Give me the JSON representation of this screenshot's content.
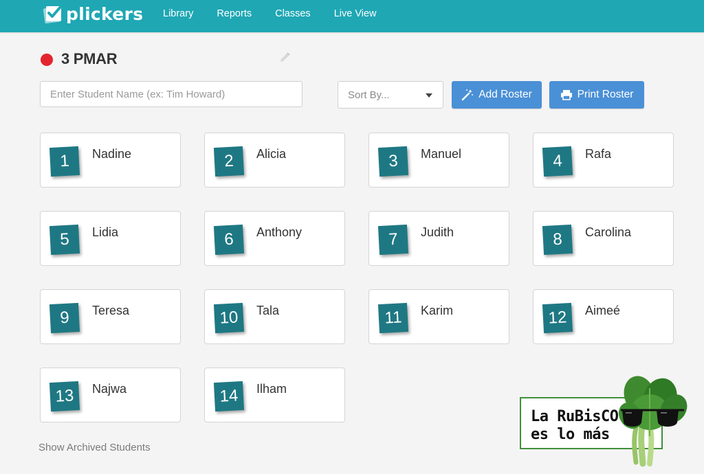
{
  "app": {
    "logo_text": "plickers"
  },
  "nav": {
    "items": [
      {
        "label": "Library"
      },
      {
        "label": "Reports"
      },
      {
        "label": "Classes"
      },
      {
        "label": "Live View"
      }
    ]
  },
  "header": {
    "class_name": "3 PMAR",
    "status_color": "#e3262d"
  },
  "controls": {
    "search_placeholder": "Enter Student Name (ex: Tim Howard)",
    "sort_label": "Sort By...",
    "add_roster_label": "Add Roster",
    "print_roster_label": "Print Roster"
  },
  "students": [
    {
      "number": "1",
      "name": "Nadine"
    },
    {
      "number": "2",
      "name": "Alicia"
    },
    {
      "number": "3",
      "name": "Manuel"
    },
    {
      "number": "4",
      "name": "Rafa"
    },
    {
      "number": "5",
      "name": "Lidia"
    },
    {
      "number": "6",
      "name": "Anthony"
    },
    {
      "number": "7",
      "name": "Judith"
    },
    {
      "number": "8",
      "name": "Carolina"
    },
    {
      "number": "9",
      "name": "Teresa"
    },
    {
      "number": "10",
      "name": "Tala"
    },
    {
      "number": "11",
      "name": "Karim"
    },
    {
      "number": "12",
      "name": "Aimeé"
    },
    {
      "number": "13",
      "name": "Najwa"
    },
    {
      "number": "14",
      "name": "Ilham"
    }
  ],
  "footer": {
    "archived_link": "Show Archived Students"
  },
  "sticker": {
    "line1": "La RuBisCO",
    "line2": "es lo más"
  },
  "colors": {
    "topbar": "#1fa7b4",
    "card_number_bg": "#1e7883",
    "button": "#4a90d6",
    "sticker_border": "#3f8f3a"
  },
  "icons": {
    "logo": "check-card-icon",
    "edit": "pencil-icon",
    "add_roster": "magic-wand-icon",
    "print_roster": "printer-icon",
    "sort": "caret-down-icon"
  }
}
